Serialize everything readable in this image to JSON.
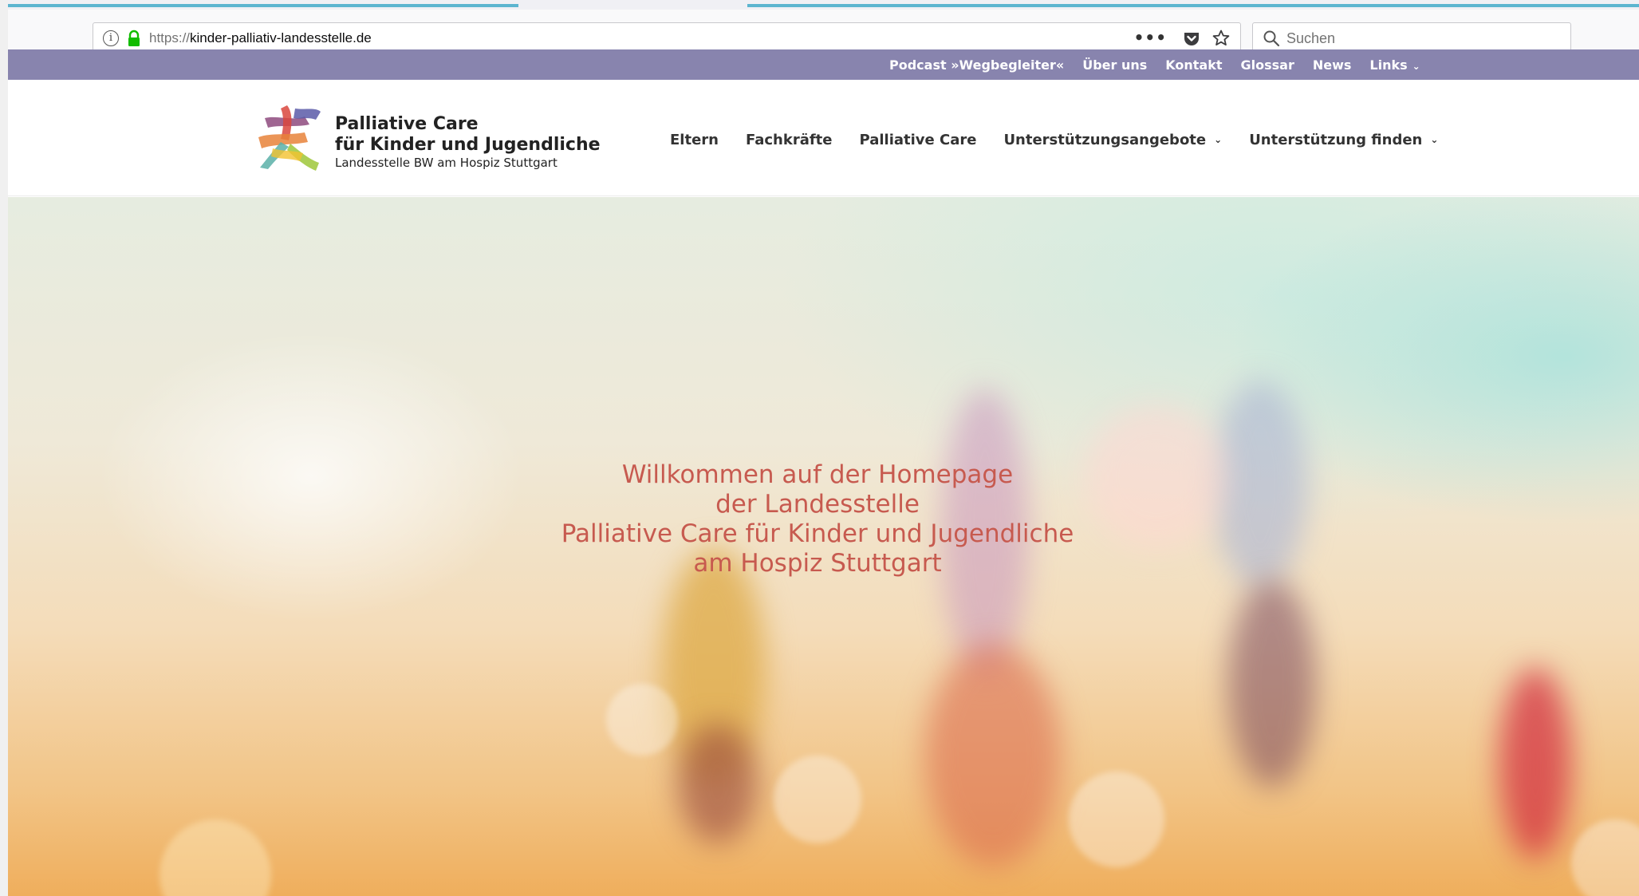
{
  "browser": {
    "url_protocol": "https://",
    "url_host": "kinder-palliativ-landesstelle.de",
    "more_label": "•••",
    "search_placeholder": "Suchen",
    "icons": [
      "info-icon",
      "lock-icon",
      "pocket-icon",
      "star-icon",
      "search-icon"
    ]
  },
  "topbar": {
    "links": [
      {
        "label": "Podcast »Wegbegleiter«"
      },
      {
        "label": "Über uns"
      },
      {
        "label": "Kontakt"
      },
      {
        "label": "Glossar"
      },
      {
        "label": "News"
      },
      {
        "label": "Links",
        "dropdown": true
      }
    ],
    "background": "#8884ae"
  },
  "header": {
    "logo": {
      "line1": "Palliative Care",
      "line2": "für Kinder und Jugendliche",
      "line3": "Landesstelle BW am Hospiz Stuttgart"
    },
    "nav": [
      {
        "label": "Eltern"
      },
      {
        "label": "Fachkräfte"
      },
      {
        "label": "Palliative Care"
      },
      {
        "label": "Unterstützungsangebote",
        "dropdown": true
      },
      {
        "label": "Unterstützung finden",
        "dropdown": true
      }
    ]
  },
  "hero": {
    "lines": [
      "Willkommen auf der Homepage",
      "der Landesstelle",
      "Palliative Care für Kinder und Jugendliche",
      "am Hospiz Stuttgart"
    ],
    "text_color": "#c75a4f"
  },
  "colors": {
    "accent_tab": "#5cb5cf"
  }
}
